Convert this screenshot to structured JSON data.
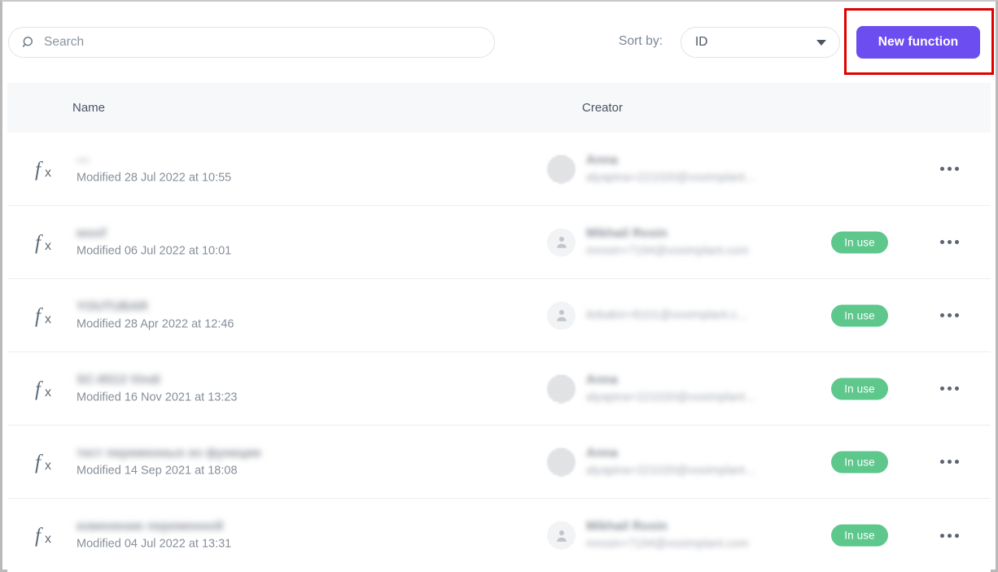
{
  "toolbar": {
    "search": {
      "icon": "search-icon",
      "placeholder": "Search",
      "value": ""
    },
    "sort": {
      "label": "Sort by:",
      "selected": "ID",
      "chevron_icon": "chevron-down-icon"
    },
    "new_function_label": "New function",
    "accent_color": "#6c4ef0",
    "highlight_color": "#e00000"
  },
  "table": {
    "columns": {
      "name": "Name",
      "creator": "Creator"
    },
    "badge_color": "#5ec88c",
    "rows": [
      {
        "icon": "fx-icon",
        "name": "—",
        "modified": "Modified 28 Jul 2022 at 10:55",
        "creator_avatar": "photo",
        "creator_name": "Anna",
        "creator_email": "alyapina+221020@voximplant…",
        "badge": "",
        "in_use": false,
        "menu_icon": "more-horizontal-icon"
      },
      {
        "icon": "fx-icon",
        "name": "woof",
        "modified": "Modified 06 Jul 2022 at 10:01",
        "creator_avatar": "person",
        "creator_name": "Mikhail Rosin",
        "creator_email": "mrosin+7194@voximplant.com",
        "badge": "In use",
        "in_use": true,
        "menu_icon": "more-horizontal-icon"
      },
      {
        "icon": "fx-icon",
        "name": "YOUTUBAR",
        "modified": "Modified 28 Apr 2022 at 12:46",
        "creator_avatar": "person",
        "creator_name": "",
        "creator_email": "ilobakin+8101@voximplant.c…",
        "badge": "In use",
        "in_use": true,
        "menu_icon": "more-horizontal-icon"
      },
      {
        "icon": "fx-icon",
        "name": "SC-6513 Vindi",
        "modified": "Modified 16 Nov 2021 at 13:23",
        "creator_avatar": "photo",
        "creator_name": "Anna",
        "creator_email": "alyapina+221020@voximplant…",
        "badge": "In use",
        "in_use": true,
        "menu_icon": "more-horizontal-icon"
      },
      {
        "icon": "fx-icon",
        "name": "тест переменных из функции",
        "modified": "Modified 14 Sep 2021 at 18:08",
        "creator_avatar": "photo",
        "creator_name": "Anna",
        "creator_email": "alyapina+221020@voximplant…",
        "badge": "In use",
        "in_use": true,
        "menu_icon": "more-horizontal-icon"
      },
      {
        "icon": "fx-icon",
        "name": "изменение переменной",
        "modified": "Modified 04 Jul 2022 at 13:31",
        "creator_avatar": "person",
        "creator_name": "Mikhail Rosin",
        "creator_email": "mrosin+7194@voximplant.com",
        "badge": "In use",
        "in_use": true,
        "menu_icon": "more-horizontal-icon"
      }
    ]
  }
}
